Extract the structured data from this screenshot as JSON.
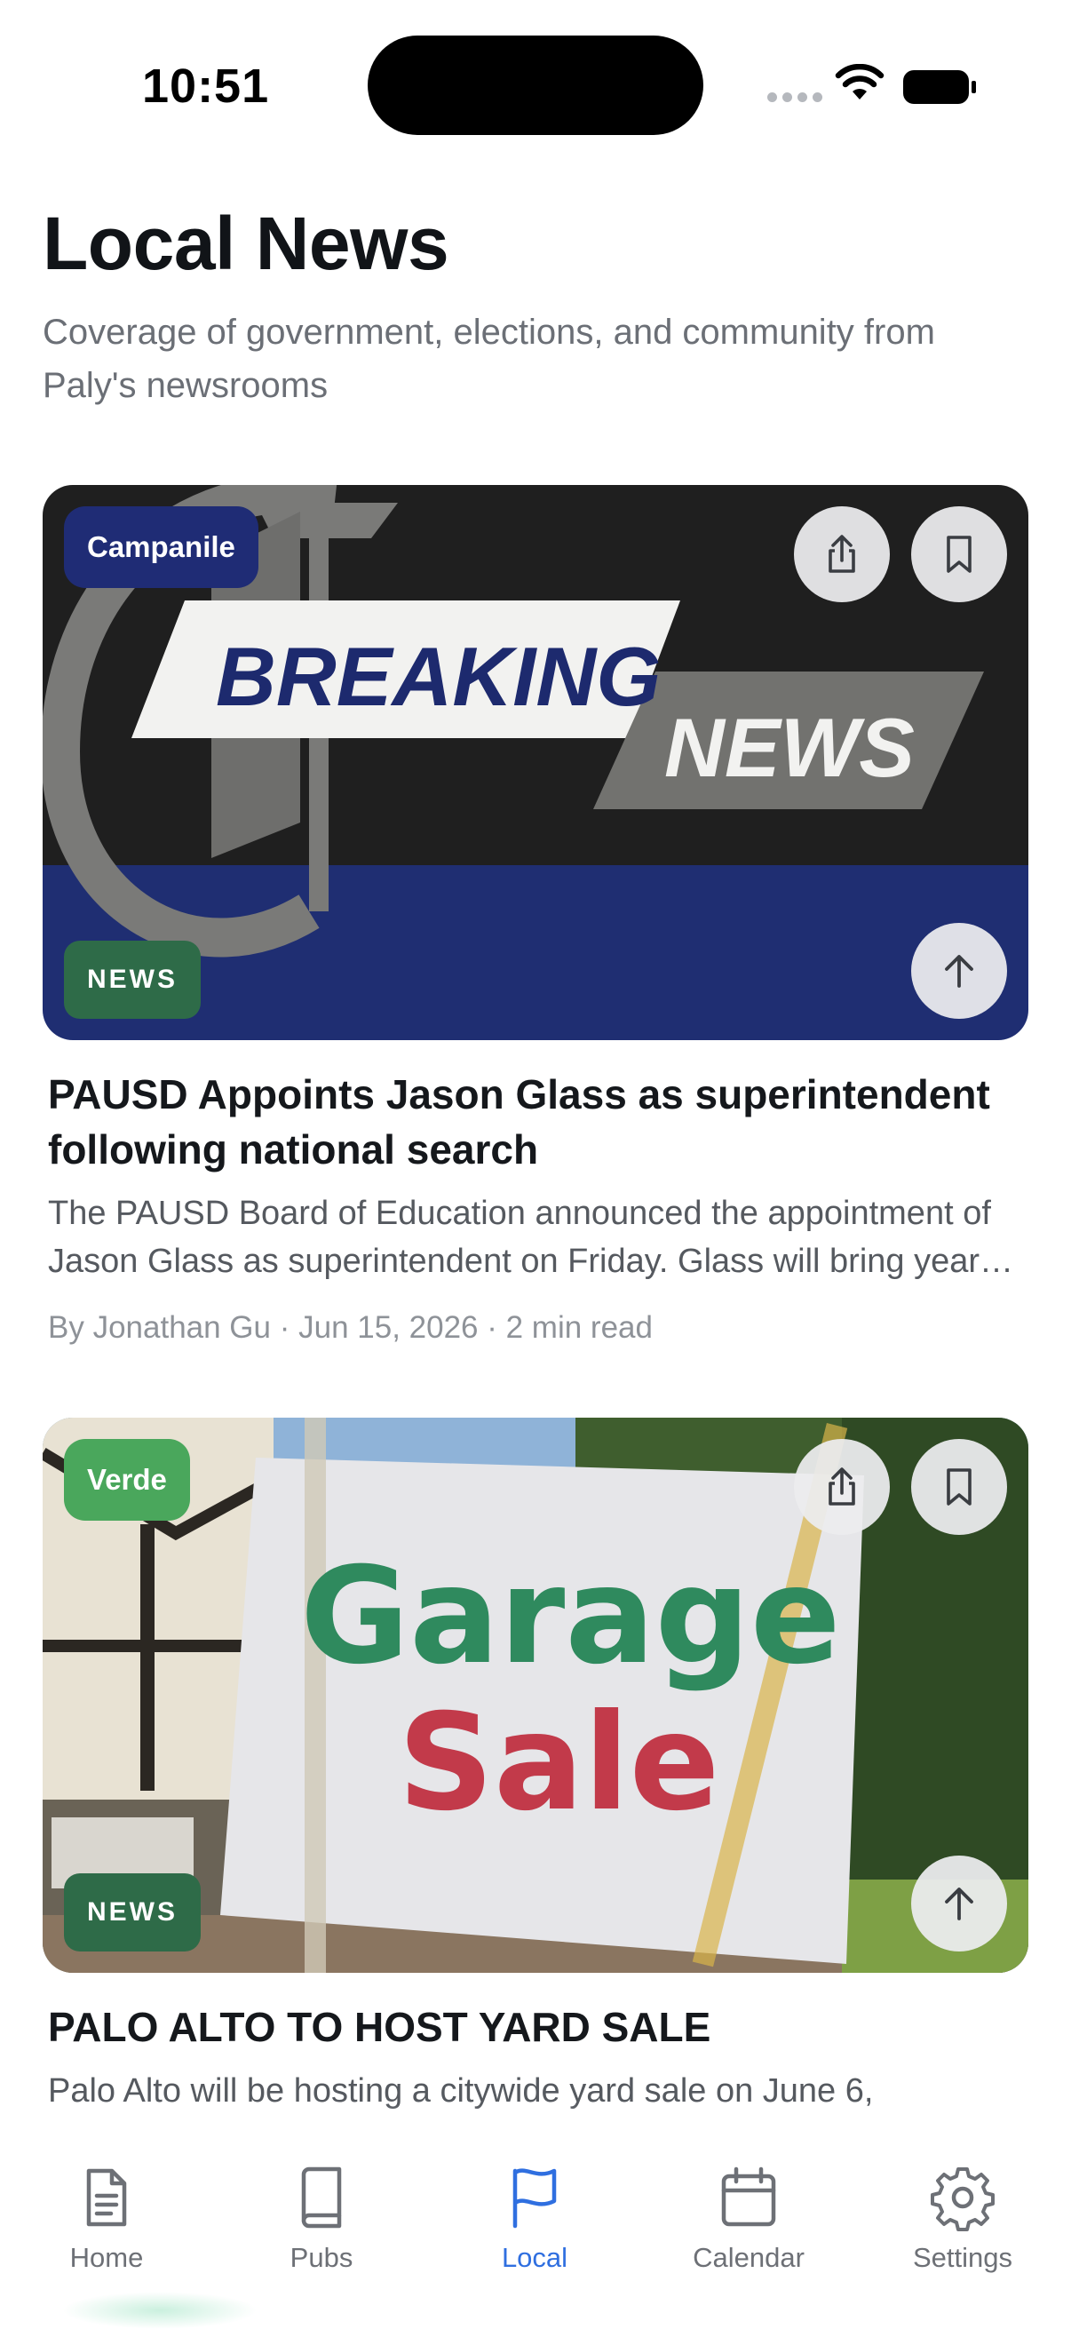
{
  "status_bar": {
    "time": "10:51",
    "icons": [
      "signal-dots-icon",
      "wifi-icon",
      "battery-icon"
    ]
  },
  "header": {
    "title": "Local News",
    "subtitle": "Coverage of government, elections, and community from Paly's newsrooms"
  },
  "articles": [
    {
      "publication": "Campanile",
      "category": "NEWS",
      "image_text": [
        "BREAKING",
        "NEWS"
      ],
      "title": "PAUSD Appoints Jason Glass as superintendent following national search",
      "summary": "The PAUSD Board of Education announced the appointment of Jason Glass as superintendent on Friday. Glass will bring years of experience leading school districts.",
      "meta": "By Jonathan Gu · Jun 15, 2026 · 2 min read",
      "colors": {
        "badge": "#1f2c75",
        "category": "#2e6b48"
      }
    },
    {
      "publication": "Verde",
      "category": "NEWS",
      "image_text": [
        "Garage",
        "Sale"
      ],
      "title": "PALO ALTO TO HOST YARD SALE",
      "summary": "Palo Alto will be hosting a citywide yard sale on June 6,",
      "colors": {
        "badge": "#4aa75c",
        "category": "#2e6b48"
      }
    }
  ],
  "tab_bar": {
    "active": "Local",
    "accent": "#2f6fe0",
    "tabs": [
      {
        "label": "Home",
        "icon": "document-icon"
      },
      {
        "label": "Pubs",
        "icon": "book-icon"
      },
      {
        "label": "Local",
        "icon": "flag-icon"
      },
      {
        "label": "Calendar",
        "icon": "calendar-icon"
      },
      {
        "label": "Settings",
        "icon": "gear-icon"
      }
    ]
  }
}
